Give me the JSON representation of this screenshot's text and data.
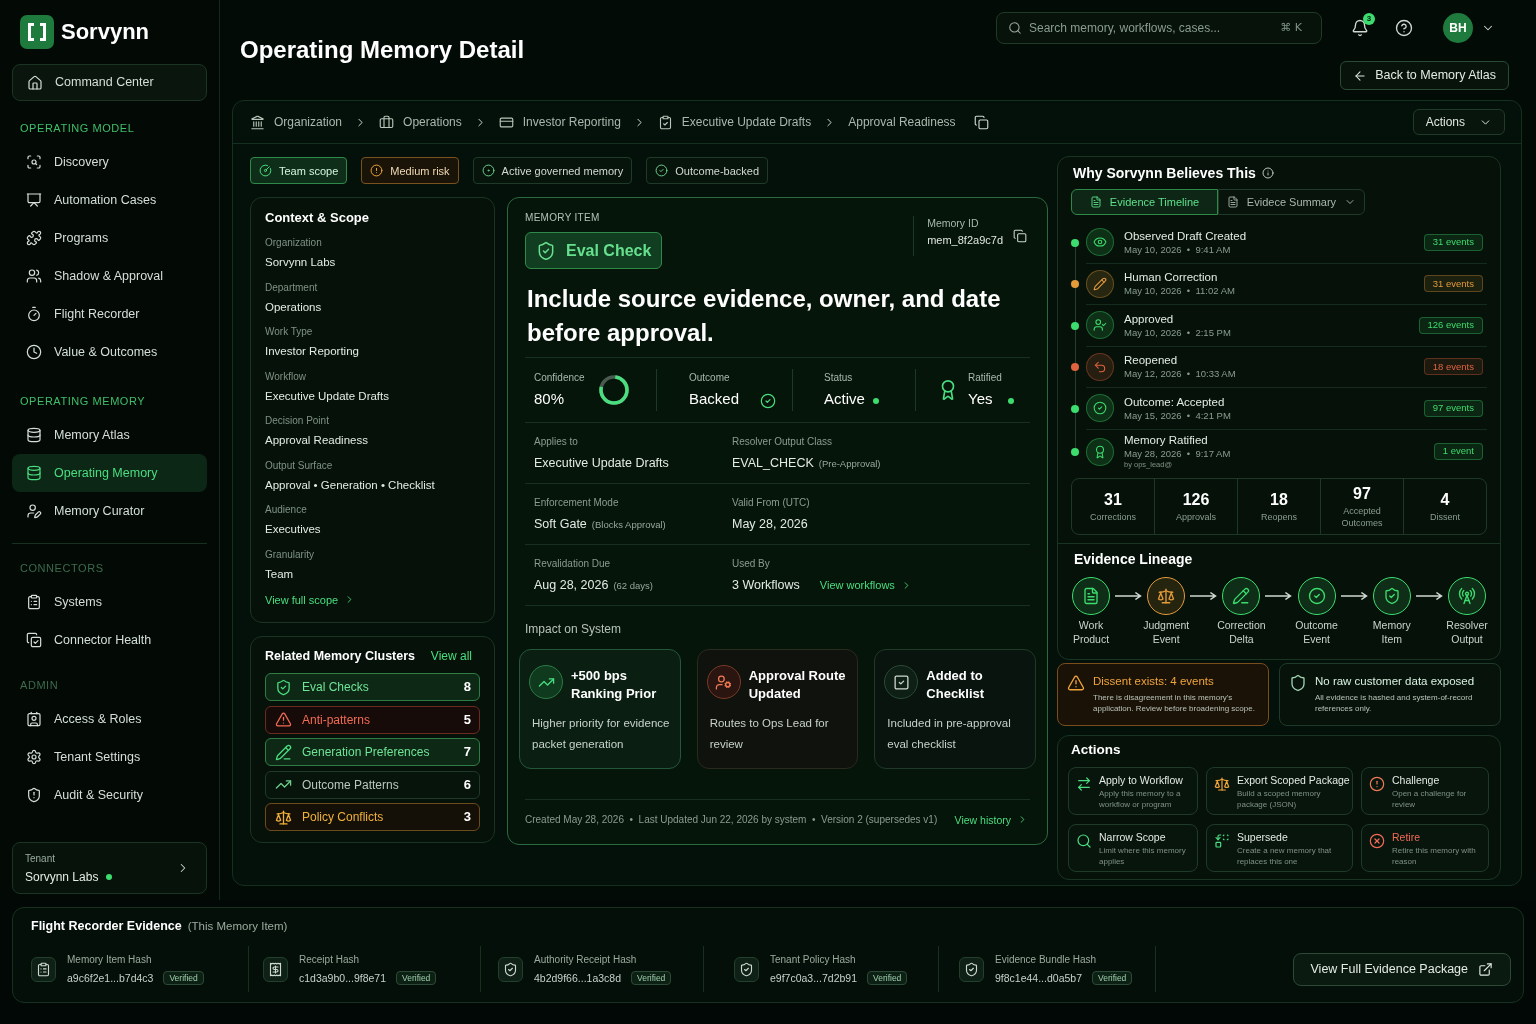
{
  "sidebar": {
    "brand": "Sorvynn",
    "home_item": {
      "label": "Command Center",
      "selected": false
    },
    "sections": [
      {
        "title": "OPERATING MODEL",
        "highlighted": true,
        "items": [
          {
            "label": "Discovery",
            "selected": false
          },
          {
            "label": "Automation Cases",
            "selected": false
          },
          {
            "label": "Programs",
            "selected": false
          },
          {
            "label": "Shadow & Approval",
            "selected": false
          },
          {
            "label": "Flight Recorder",
            "selected": false
          },
          {
            "label": "Value & Outcomes",
            "selected": false
          }
        ]
      },
      {
        "title": "OPERATING MEMORY",
        "highlighted": true,
        "items": [
          {
            "label": "Memory Atlas",
            "selected": false
          },
          {
            "label": "Operating Memory",
            "selected": true
          },
          {
            "label": "Memory Curator",
            "selected": false
          }
        ]
      },
      {
        "title": "CONNECTORS",
        "highlighted": false,
        "items": [
          {
            "label": "Systems",
            "selected": false
          },
          {
            "label": "Connector Health",
            "selected": false
          }
        ]
      },
      {
        "title": "ADMIN",
        "highlighted": false,
        "items": [
          {
            "label": "Access & Roles",
            "selected": false
          },
          {
            "label": "Tenant Settings",
            "selected": false
          },
          {
            "label": "Audit & Security",
            "selected": false
          }
        ]
      }
    ],
    "tenant": {
      "label": "Tenant",
      "name": "Sorvynn Labs"
    }
  },
  "header": {
    "title": "Operating Memory Detail",
    "search": {
      "placeholder": "Search memory, workflows, cases...",
      "shortcut": "⌘ K"
    },
    "notification_count": "3",
    "avatar": "BH",
    "back_button": "Back to Memory Atlas"
  },
  "breadcrumb": {
    "items": [
      "Organization",
      "Operations",
      "Investor Reporting",
      "Executive Update Drafts",
      "Approval Readiness"
    ],
    "actions_button": "Actions"
  },
  "tags": [
    {
      "label": "Team scope",
      "kind": "scope"
    },
    {
      "label": "Medium risk",
      "kind": "risk"
    },
    {
      "label": "Active governed memory",
      "kind": "plain"
    },
    {
      "label": "Outcome-backed",
      "kind": "plain"
    }
  ],
  "context": {
    "title": "Context & Scope",
    "fields": [
      {
        "label": "Organization",
        "value": "Sorvynn Labs"
      },
      {
        "label": "Department",
        "value": "Operations"
      },
      {
        "label": "Work Type",
        "value": "Investor Reporting"
      },
      {
        "label": "Workflow",
        "value": "Executive Update Drafts"
      },
      {
        "label": "Decision Point",
        "value": "Approval Readiness"
      },
      {
        "label": "Output Surface",
        "value": "Approval • Generation • Checklist"
      },
      {
        "label": "Audience",
        "value": "Executives"
      },
      {
        "label": "Granularity",
        "value": "Team"
      }
    ],
    "link": "View full scope"
  },
  "clusters": {
    "title": "Related Memory Clusters",
    "link": "View all",
    "items": [
      {
        "label": "Eval Checks",
        "count": "8",
        "kind": "positive"
      },
      {
        "label": "Anti-patterns",
        "count": "5",
        "kind": "danger"
      },
      {
        "label": "Generation Preferences",
        "count": "7",
        "kind": "positive"
      },
      {
        "label": "Outcome Patterns",
        "count": "6",
        "kind": "neutral"
      },
      {
        "label": "Policy Conflicts",
        "count": "3",
        "kind": "warning"
      }
    ]
  },
  "memory_item": {
    "eyebrow": "MEMORY ITEM",
    "type_badge": "Eval Check",
    "id_label": "Memory ID",
    "id": "mem_8f2a9c7d",
    "statement": "Include source evidence, owner, and date before approval.",
    "stats": [
      {
        "kind": "ring",
        "label": "Confidence",
        "value": "80%",
        "level": 0.8
      },
      {
        "kind": "check",
        "label": "Outcome",
        "value": "Backed"
      },
      {
        "kind": "dot",
        "label": "Status",
        "value": "Active"
      },
      {
        "kind": "award",
        "label": "Ratified",
        "value": "Yes"
      }
    ],
    "fields": [
      {
        "label": "Applies to",
        "value": "Executive Update Drafts"
      },
      {
        "label": "Resolver Output Class",
        "value": "EVAL_CHECK",
        "note": "(Pre-Approval)"
      },
      {
        "label": "Enforcement Mode",
        "value": "Soft Gate",
        "note": "(Blocks Approval)"
      },
      {
        "label": "Valid From (UTC)",
        "value": "May 28, 2026"
      },
      {
        "label": "Revalidation Due",
        "value": "Aug 28, 2026",
        "note": "(62 days)"
      },
      {
        "label": "Used By",
        "value": "3 Workflows",
        "link": "View workflows"
      }
    ],
    "impact_title": "Impact on System",
    "impacts": [
      {
        "kind": "positive",
        "title": "+500 bps Ranking Prior",
        "text": "Higher priority for evidence packet generation"
      },
      {
        "kind": "warning",
        "title": "Approval Route Updated",
        "text": "Routes to Ops Lead for review"
      },
      {
        "kind": "neutral",
        "title": "Added to Checklist",
        "text": "Included in pre-approval eval checklist"
      }
    ],
    "footer": "Created May 28, 2026  •  Last Updated Jun 22, 2026 by system  •  Version 2 (supersedes v1)",
    "history_link": "View history"
  },
  "evidence": {
    "title": "Why Sorvynn Believes This",
    "tabs": [
      {
        "label": "Evidence Timeline",
        "selected": true
      },
      {
        "label": "Evidece Summary",
        "selected": false
      }
    ],
    "timeline": [
      {
        "kind": "observed",
        "title": "Observed Draft Created",
        "when": "May 10, 2026  •  9:41 AM",
        "events": "31 events",
        "color": "#3ddc6e"
      },
      {
        "kind": "correction",
        "title": "Human Correction",
        "when": "May 10, 2026  •  11:02 AM",
        "events": "31 events",
        "color": "#e39a3b"
      },
      {
        "kind": "approved",
        "title": "Approved",
        "when": "May 10, 2026  •  2:15 PM",
        "events": "126 events",
        "color": "#3ddc6e"
      },
      {
        "kind": "reopened",
        "title": "Reopened",
        "when": "May 12, 2026  •  10:33 AM",
        "events": "18 events",
        "color": "#e0633f"
      },
      {
        "kind": "outcome",
        "title": "Outcome: Accepted",
        "when": "May 15, 2026  •  4:21 PM",
        "events": "97 events",
        "color": "#3ddc6e"
      },
      {
        "kind": "ratified",
        "title": "Memory Ratified",
        "when": "May 28, 2026  •  9:17 AM",
        "by": "by ops_lead@",
        "events": "1 event",
        "color": "#3ddc6e"
      }
    ],
    "totals": [
      {
        "value": "31",
        "label": "Corrections"
      },
      {
        "value": "126",
        "label": "Approvals"
      },
      {
        "value": "18",
        "label": "Reopens"
      },
      {
        "value": "97",
        "label": "Accepted Outcomes"
      },
      {
        "value": "4",
        "label": "Dissent"
      }
    ],
    "lineage_title": "Evidence Lineage",
    "lineage": [
      {
        "kind": "work",
        "label": "Work Product",
        "color": "#3ddc6e"
      },
      {
        "kind": "judgment",
        "label": "Judgment Event",
        "color": "#e39a3b"
      },
      {
        "kind": "correction",
        "label": "Correction Delta",
        "color": "#3ddc6e"
      },
      {
        "kind": "outcome",
        "label": "Outcome Event",
        "color": "#3ddc6e"
      },
      {
        "kind": "memory",
        "label": "Memory Item",
        "color": "#3ddc6e"
      },
      {
        "kind": "resolver",
        "label": "Resolver Output",
        "color": "#3ddc6e"
      }
    ]
  },
  "alerts": [
    {
      "kind": "warning",
      "title": "Dissent exists: 4 events",
      "text": "There is disagreement in this memory's application. Review before broadening scope."
    },
    {
      "kind": "info",
      "title": "No raw customer data exposed",
      "text": "All evidence is hashed and system-of-record references only."
    }
  ],
  "actions": {
    "title": "Actions",
    "items": [
      {
        "kind": "apply",
        "title": "Apply to Workflow",
        "text": "Apply this memory to a workflow or program"
      },
      {
        "kind": "export",
        "title": "Export Scoped Package",
        "text": "Build a scoped memory package (JSON)"
      },
      {
        "kind": "challenge",
        "title": "Challenge",
        "text": "Open a challenge for review"
      },
      {
        "kind": "narrow",
        "title": "Narrow Scope",
        "text": "Limit where this memory applies"
      },
      {
        "kind": "supersede",
        "title": "Supersede",
        "text": "Create a new memory that replaces this one"
      },
      {
        "kind": "retire",
        "title": "Retire",
        "text": "Retire this memory with reason"
      }
    ]
  },
  "flight_recorder": {
    "title": "Flight Recorder Evidence",
    "subtitle": "(This Memory Item)",
    "hashes": [
      {
        "label": "Memory Item Hash",
        "value": "a9c6f2e1...b7d4c3",
        "status": "Verified"
      },
      {
        "label": "Receipt Hash",
        "value": "c1d3a9b0...9f8e71",
        "status": "Verified"
      },
      {
        "label": "Authority Receipt Hash",
        "value": "4b2d9f66...1a3c8d",
        "status": "Verified"
      },
      {
        "label": "Tenant Policy Hash",
        "value": "e9f7c0a3...7d2b91",
        "status": "Verified"
      },
      {
        "label": "Evidence Bundle Hash",
        "value": "9f8c1e44...d0a5b7",
        "status": "Verified"
      }
    ],
    "button": "View Full Evidence Package"
  }
}
